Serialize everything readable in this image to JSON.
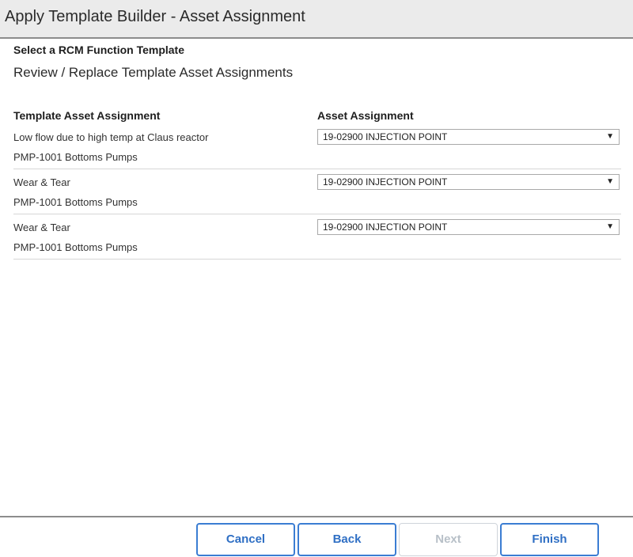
{
  "window": {
    "title": "Apply Template Builder - Asset Assignment"
  },
  "step": {
    "title": "Select a RCM Function Template",
    "subtitle": "Review / Replace Template Asset Assignments"
  },
  "table": {
    "headers": {
      "template_asset_assignment": "Template Asset Assignment",
      "asset_assignment": "Asset Assignment"
    },
    "rows": [
      {
        "function": "Low flow due to high temp at Claus reactor",
        "template_asset": "PMP-1001 Bottoms Pumps",
        "asset_assignment": "19-02900 INJECTION POINT"
      },
      {
        "function": "Wear & Tear",
        "template_asset": "PMP-1001 Bottoms Pumps",
        "asset_assignment": "19-02900 INJECTION POINT"
      },
      {
        "function": "Wear & Tear",
        "template_asset": "PMP-1001 Bottoms Pumps",
        "asset_assignment": "19-02900 INJECTION POINT"
      }
    ]
  },
  "dropdown_icon": "chevron-down-icon",
  "buttons": {
    "cancel": "Cancel",
    "back": "Back",
    "next": "Next",
    "finish": "Finish"
  },
  "colors": {
    "accent": "#3b7dd3",
    "disabled": "#b8c0c8",
    "title_bar": "#ebebeb"
  }
}
